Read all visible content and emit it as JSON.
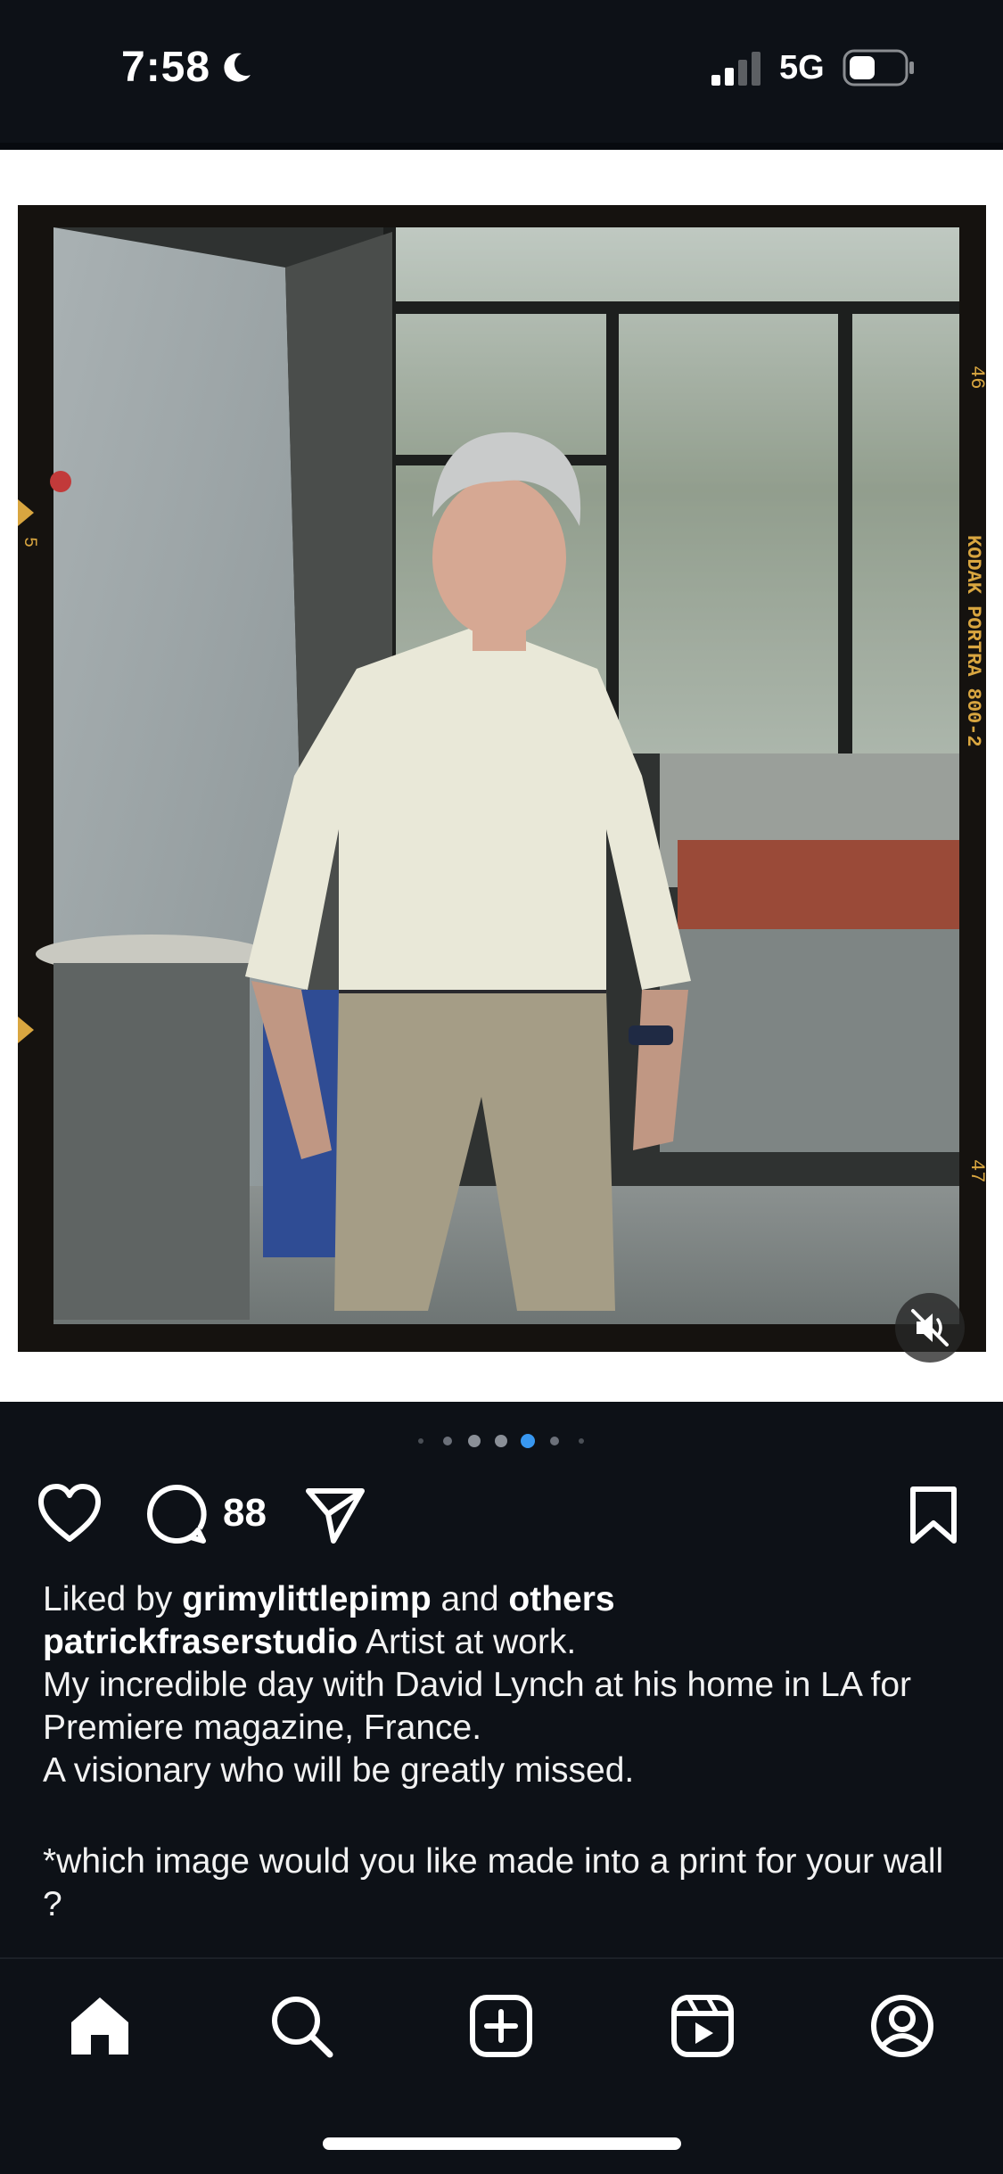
{
  "status_bar": {
    "time": "7:58",
    "network": "5G",
    "icons": [
      "moon-icon",
      "signal-icon",
      "battery-icon"
    ]
  },
  "post": {
    "film_edge_text": {
      "left_number": "5",
      "right_top": "46",
      "right_brand": "KODAK PORTRA 800-2",
      "right_bottom": "47"
    },
    "carousel": {
      "count": 7,
      "active_index": 4
    },
    "comment_count": "88",
    "likes": {
      "prefix": "Liked by",
      "user": "grimylittlepimp",
      "connector": "and",
      "others": "others"
    },
    "caption": {
      "username": "patrickfraserstudio",
      "lines": [
        "Artist at work.",
        "My incredible day with David Lynch at his home in LA for Premiere magazine, France.",
        "A visionary who will be greatly missed."
      ],
      "question": "*which image would you like made into a print for your wall ?"
    }
  },
  "tabs": [
    "home-icon",
    "search-icon",
    "create-icon",
    "reels-icon",
    "profile-icon"
  ],
  "colors": {
    "background": "#0d1117",
    "accent_dot": "#3897f0"
  }
}
